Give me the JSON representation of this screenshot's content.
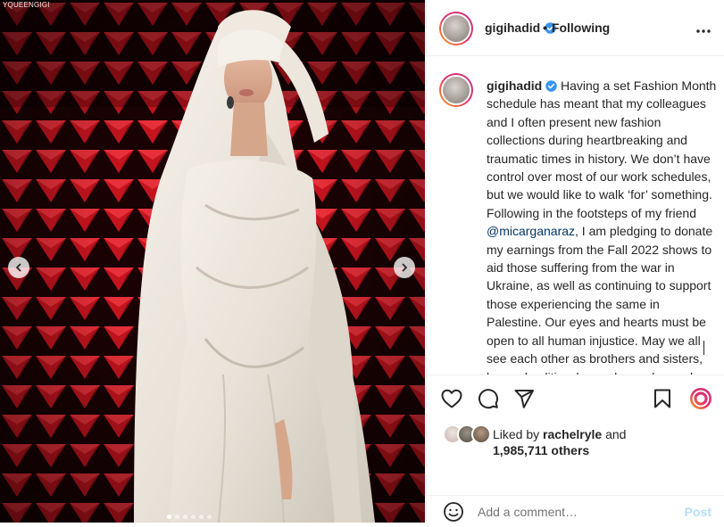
{
  "photo": {
    "watermark": "YQUEENGIGI",
    "carousel_dots": 6,
    "active_dot": 1
  },
  "header": {
    "username": "gigihadid",
    "following_label": "Following",
    "more_icon": "more-horizontal-icon"
  },
  "caption": {
    "username": "gigihadid",
    "text_before_mention": "Having a set Fashion Month schedule has meant that my colleagues and I often present new fashion collections during heartbreaking and traumatic times in history. We don’t have control over most of our work schedules, but we would like to walk ‘for’ something. Following in the footsteps of my friend ",
    "mention": "@micarganaraz",
    "text_after_mention": ", I am pledging to donate my earnings from the Fall 2022 shows to aid those suffering from the war in Ukraine, as well as continuing to support those experiencing the same in Palestine. Our eyes and hearts must be open to all human injustice. May we all see each other as brothers and sisters, beyond politics, beyond race, beyond religion. At the the end of the day, innocent lives are forever at risk when"
  },
  "actions": {
    "like_icon": "heart-icon",
    "comment_icon": "comment-icon",
    "share_icon": "send-icon",
    "save_icon": "bookmark-icon",
    "reel_icon": "instagram-badge-icon"
  },
  "likes": {
    "prefix": "Liked by ",
    "liked_by_user": "rachelryle",
    "and_label": " and",
    "others_count": "1,985,711 others"
  },
  "comment": {
    "emoji_icon": "smiley-icon",
    "placeholder": "Add a comment…",
    "post_label": "Post"
  },
  "colors": {
    "accent_link": "#00376b",
    "post_disabled": "#b2dffc",
    "verified_blue": "#3897f0",
    "ring_gradient": [
      "#f9a11b",
      "#e1306c",
      "#c13584"
    ]
  }
}
